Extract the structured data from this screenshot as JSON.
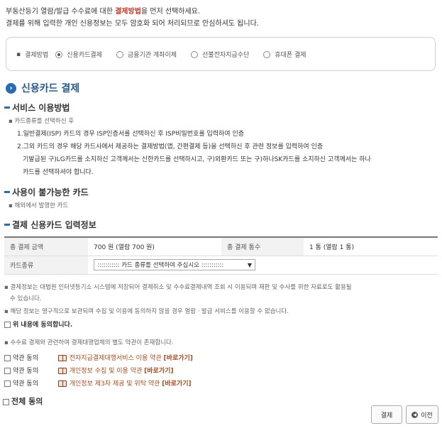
{
  "intro": {
    "line1_pre": "부동산등기 열람/발급 수수료에 대한 ",
    "line1_hl": "결제방법",
    "line1_post": "을 먼저 선택하세요.",
    "line2": "결제를 위해 입력한 개인 신용정보는 모두 암호화 되어 처리되므로 안심하셔도 됩니다."
  },
  "method": {
    "label": "결제방법",
    "options": [
      {
        "label": "신용카드결제",
        "selected": true
      },
      {
        "label": "금융기관 계좌이체",
        "selected": false
      },
      {
        "label": "선불전자지급수단",
        "selected": false
      },
      {
        "label": "휴대폰 결제",
        "selected": false
      }
    ]
  },
  "section_title": "신용카드 결제",
  "usage": {
    "title": "서비스 이용방법",
    "lines": [
      "카드종류를 선택하신 후",
      "1.일반결제(ISP) 카드의 경우 ISP인증서를 선택하신 후 ISP비밀번호를 입력하여 인증",
      "2.그외 카드의 경우 해당 카드사에서 제공하는 결제방법(앱, 간편결제 등)을 선택하신 후 관련 정보를 입력하여 인증",
      "기발급된 구)LG카드를 소지하신 고객께서는 신한카드를 선택하시고, 구)외환카드 또는 구)하나SK카드를 소지하신 고객께서는 하나",
      "카드를 선택하셔야 합니다."
    ]
  },
  "unavailable": {
    "title": "사용이 불가능한 카드",
    "line": "해외에서 발행한 카드"
  },
  "card_info": {
    "title": "결제 신용카드 입력정보",
    "total_amount_label": "총 결제 금액",
    "total_amount_value": "700 원 (열람 700 원)",
    "total_count_label": "총 결제 통수",
    "total_count_value": "1 통 (열람 1 통)",
    "card_type_label": "카드종류",
    "card_type_select": "::::::::::: 카드 종류를 선택하여 주십시오 :::::::::::"
  },
  "notices": {
    "n1a": "결제정보는 대법원 인터넷등기소 시스템에 저장되어 결제취소 및 수수료결제내역 조회 시 이용되며 재판 및 수사를 위한 자료로도 활용될",
    "n1b": "수 있습니다.",
    "n2": "해당 정보는 영구적으로 보관되며 수집 및 이용에 동의하지 않을 경우 열람ㆍ발급 서비스를 이용할 수 없습니다.",
    "agree_above": "위 내용에 동의합니다.",
    "n3": "수수료 결제와 관련하여 결제대행업체의 별도 약관이 존재합니다."
  },
  "terms": [
    {
      "agree": "약관 동의",
      "text": "전자지급결제대행서비스 이용 약관",
      "link": "[바로가기]"
    },
    {
      "agree": "약관 동의",
      "text": "개인정보 수집 및 이용 약관",
      "link": "[바로가기]"
    },
    {
      "agree": "약관 동의",
      "text": "개인정보 제3자 제공 및 위탁 약관",
      "link": "[바로가기]"
    }
  ],
  "agree_all": "전체 동의",
  "buttons": {
    "pay": "결제",
    "prev": "이전"
  },
  "colors": {
    "accent": "#2b6cb0",
    "highlight": "#c0392b",
    "link": "#a34b1e"
  }
}
